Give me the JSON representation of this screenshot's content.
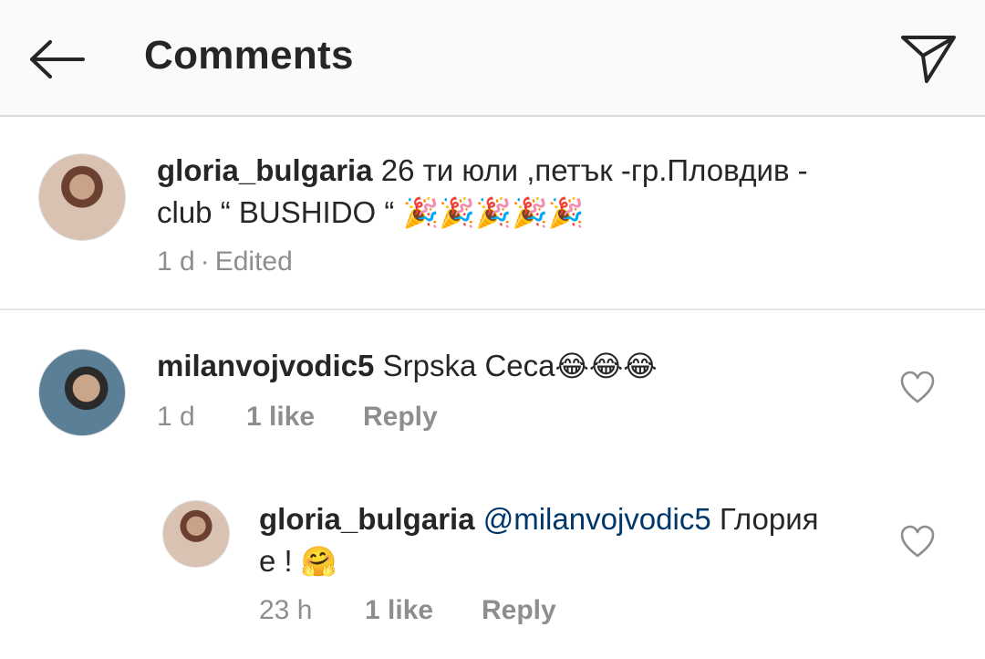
{
  "header": {
    "title": "Comments"
  },
  "caption": {
    "username": "gloria_bulgaria",
    "text_line1": "26 ти юли ,петък -гр.Пловдив -",
    "text_line2": "club “ BUSHIDO “",
    "emojis": "🎉🎉🎉🎉🎉",
    "time": "1 d",
    "separator": "·",
    "edited": "Edited"
  },
  "comments": [
    {
      "username": "milanvojvodic5",
      "text": "Srpska Ceca",
      "emojis": "😂😂😂",
      "time": "1 d",
      "likes": "1 like",
      "reply": "Reply"
    },
    {
      "username": "gloria_bulgaria",
      "mention": "@milanvojvodic5",
      "text_line1": "Глория",
      "text_line2": "е !",
      "emojis": "🤗",
      "time": "23 h",
      "likes": "1 like",
      "reply": "Reply"
    }
  ],
  "icons": {
    "back": "arrow-left-icon",
    "send": "paper-plane-icon",
    "like": "heart-icon"
  }
}
